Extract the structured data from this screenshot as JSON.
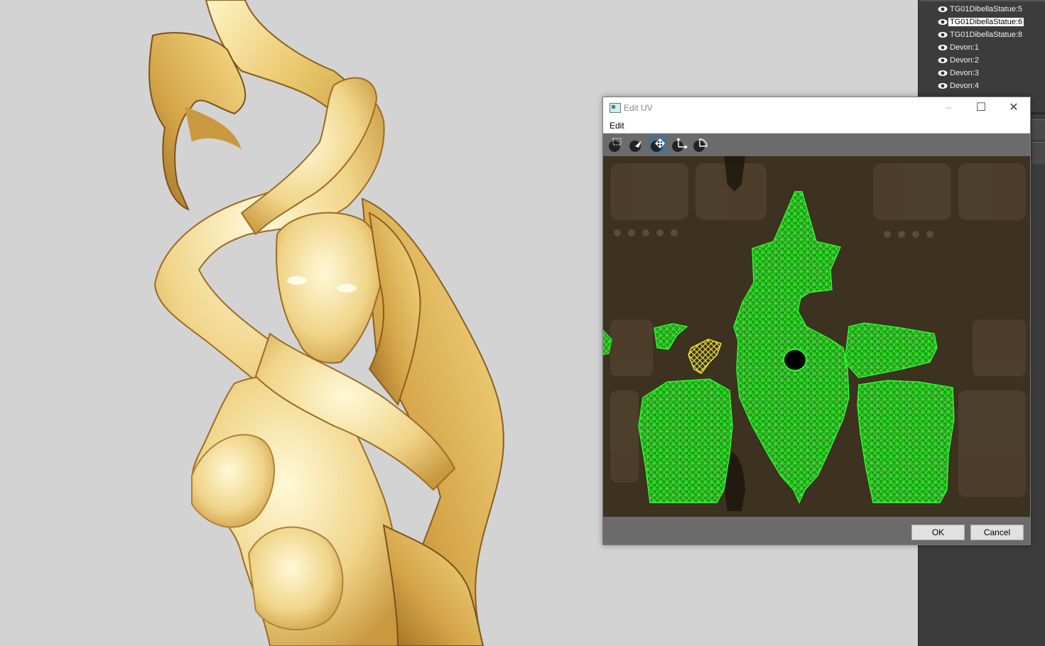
{
  "outliner": {
    "items": [
      {
        "label": "TG01DibellaStatue:5",
        "selected": false
      },
      {
        "label": "TG01DibellaStatue:6",
        "selected": true
      },
      {
        "label": "TG01DibellaStatue:8",
        "selected": false
      },
      {
        "label": "Devon:1",
        "selected": false
      },
      {
        "label": "Devon:2",
        "selected": false
      },
      {
        "label": "Devon:3",
        "selected": false
      },
      {
        "label": "Devon:4",
        "selected": false
      }
    ]
  },
  "dialog": {
    "title": "Edit UV",
    "menu": [
      "Edit"
    ],
    "tools": [
      {
        "name": "select-tool-icon",
        "active": false
      },
      {
        "name": "move-pointer-icon",
        "active": false
      },
      {
        "name": "move-tool-icon",
        "active": true
      },
      {
        "name": "scale-tool-icon",
        "active": false
      },
      {
        "name": "rotate-tool-icon",
        "active": false
      }
    ],
    "ok_label": "OK",
    "cancel_label": "Cancel"
  },
  "colors": {
    "uv_wire": "#22ee22",
    "uv_selected": "#e6e033",
    "statue": "#e8c770",
    "viewport_bg": "#d3d3d3"
  }
}
